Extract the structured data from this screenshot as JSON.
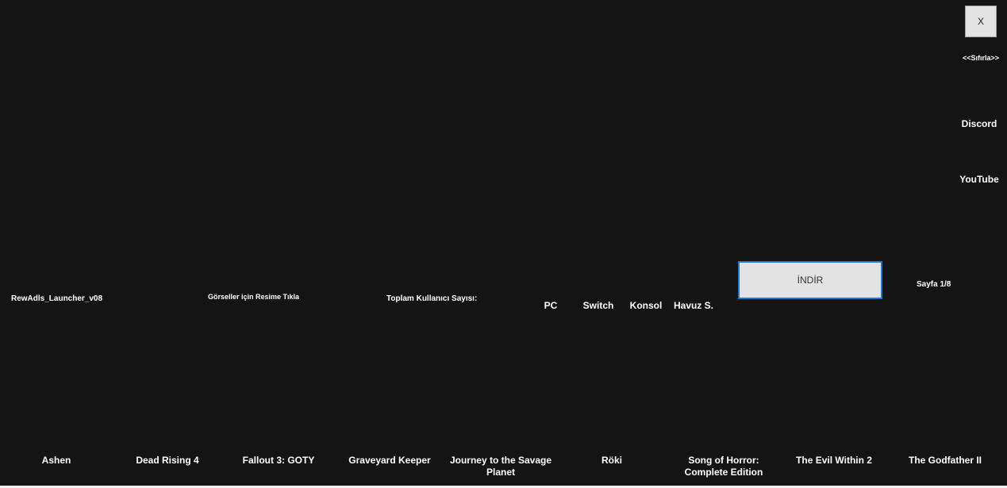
{
  "window": {
    "close_label": "X",
    "reset_label": "<<Sıfırla>>"
  },
  "links": {
    "discord": "Discord",
    "youtube": "YouTube"
  },
  "info": {
    "launcher_name": "RewAdls_Launcher_v08",
    "images_hint": "Görseller için Resime Tıkla",
    "total_users_label": "Toplam Kullanıcı Sayısı:",
    "page_indicator": "Sayfa 1/8"
  },
  "filters": [
    "PC",
    "Switch",
    "Konsol",
    "Havuz S."
  ],
  "download_label": "İNDİR",
  "games": [
    "Ashen",
    "Dead Rising 4",
    "Fallout 3: GOTY",
    "Graveyard Keeper",
    "Journey to the Savage Planet",
    "Röki",
    "Song of Horror: Complete Edition",
    "The Evil Within 2",
    "The Godfather II"
  ]
}
